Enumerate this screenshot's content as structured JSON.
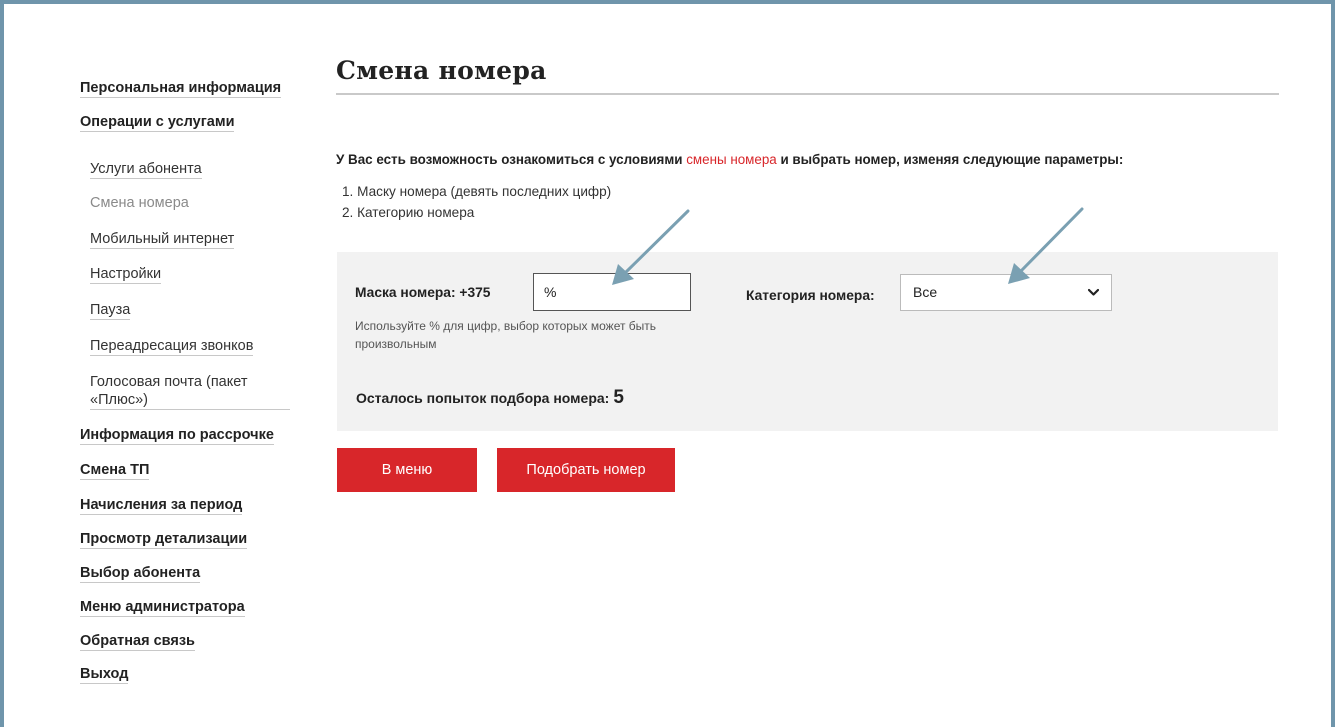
{
  "sidebar": {
    "items": [
      {
        "label": "Персональная информация"
      },
      {
        "label": "Операции с услугами"
      },
      {
        "label": "Услуги абонента"
      },
      {
        "label": "Смена номера"
      },
      {
        "label": "Мобильный интернет"
      },
      {
        "label": "Настройки"
      },
      {
        "label": "Пауза"
      },
      {
        "label": "Переадресация звонков"
      },
      {
        "label": "Голосовая почта (пакет «Плюс»)"
      },
      {
        "label": "Информация по рассрочке"
      },
      {
        "label": "Смена ТП"
      },
      {
        "label": "Начисления за период"
      },
      {
        "label": "Просмотр детализации"
      },
      {
        "label": "Выбор абонента"
      },
      {
        "label": "Меню администратора"
      },
      {
        "label": "Обратная связь"
      },
      {
        "label": "Выход"
      }
    ]
  },
  "main": {
    "title": "Смена номера",
    "intro_before": "У Вас есть возможность ознакомиться с условиями ",
    "intro_link": "смены номера",
    "intro_after": " и выбрать номер, изменяя следующие параметры:",
    "list": [
      "1. Маску номера (девять последних цифр)",
      "2. Категорию номера"
    ],
    "mask_label": "Маска номера: +375",
    "mask_value": "%",
    "hint": "Используйте % для цифр, выбор которых может быть произвольным",
    "category_label": "Категория номера:",
    "category_value": "Все",
    "attempts_label": "Осталось попыток подбора номера:",
    "attempts_value": "5",
    "btn_menu": "В меню",
    "btn_pick": "Подобрать номер"
  },
  "colors": {
    "accent_red": "#d8262a",
    "frame": "#6f95ab",
    "arrow": "#7aa0b2",
    "panel_bg": "#f2f2f2"
  }
}
